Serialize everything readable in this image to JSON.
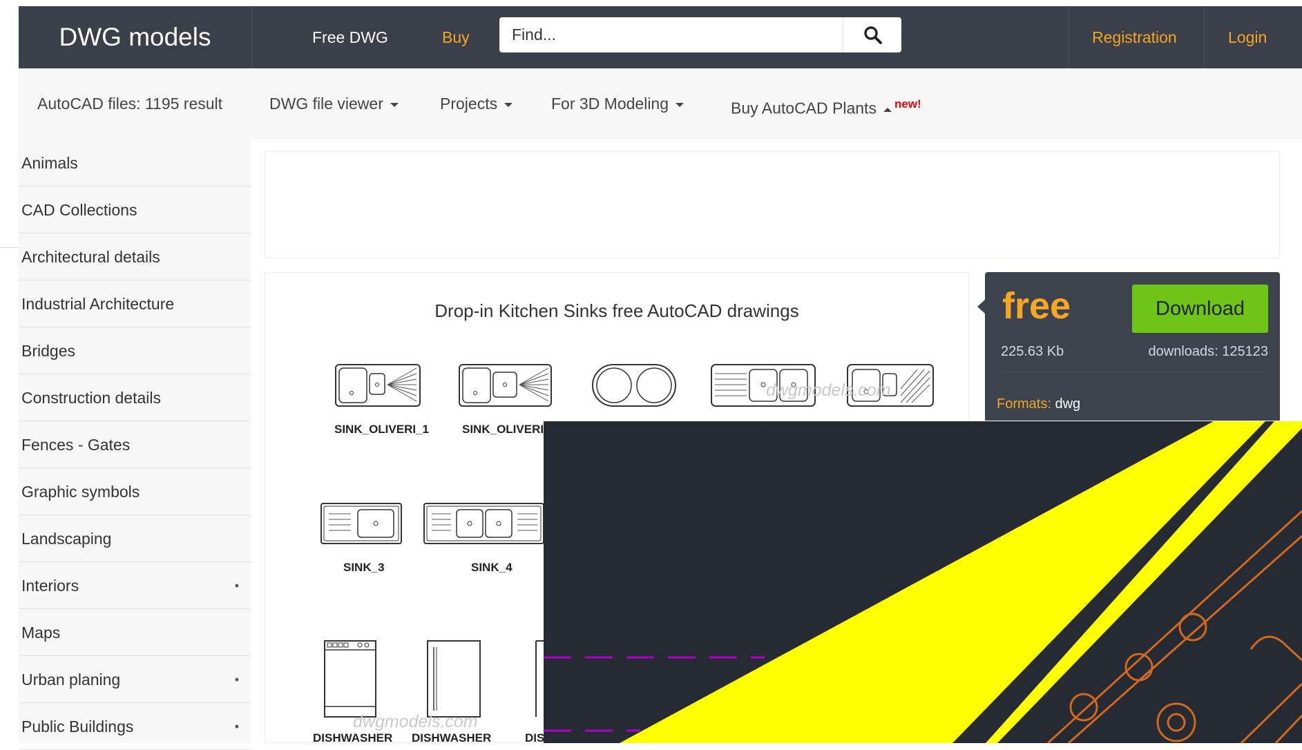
{
  "header": {
    "logo": "DWG models",
    "free_dwg": "Free DWG",
    "buy": "Buy",
    "search_placeholder": "Find...",
    "registration": "Registration",
    "login": "Login"
  },
  "subnav": {
    "result_text": "AutoCAD files: 1195 result",
    "items": [
      {
        "label": "DWG file viewer"
      },
      {
        "label": "Projects"
      },
      {
        "label": "For 3D Modeling"
      },
      {
        "label": "Buy AutoCAD Plants"
      }
    ],
    "new_badge": "new!"
  },
  "sidebar": {
    "items": [
      {
        "label": "Animals",
        "sub": ""
      },
      {
        "label": "CAD Collections",
        "sub": ""
      },
      {
        "label": "Architectural details",
        "sub": ""
      },
      {
        "label": "Industrial Architecture",
        "sub": ""
      },
      {
        "label": "Bridges",
        "sub": ""
      },
      {
        "label": "Construction details",
        "sub": ""
      },
      {
        "label": "Fences - Gates",
        "sub": ""
      },
      {
        "label": "Graphic symbols",
        "sub": ""
      },
      {
        "label": "Landscaping",
        "sub": ""
      },
      {
        "label": "Interiors",
        "sub": "•"
      },
      {
        "label": "Maps",
        "sub": ""
      },
      {
        "label": "Urban planing",
        "sub": "•"
      },
      {
        "label": "Public Buildings",
        "sub": "•"
      }
    ]
  },
  "content": {
    "title": "Drop-in Kitchen Sinks free AutoCAD drawings",
    "watermark": "dwgmodels.com",
    "labels": [
      "SINK_OLIVERI_1",
      "SINK_OLIVERI",
      "SINK_3",
      "SINK_4",
      "DISHWASHER",
      "DISHWASHER",
      "DIS"
    ]
  },
  "download": {
    "price": "free",
    "button": "Download",
    "size": "225.63 Kb",
    "downloads": "downloads: 125123",
    "formats_label": "Formats:",
    "formats_value": "dwg"
  },
  "colors": {
    "header_bg": "#3a3f49",
    "accent": "#f5a623",
    "download_btn": "#6ec517",
    "overlay_bg": "#262a33",
    "stripe": "#ffff00",
    "cad_orange": "#d2691e",
    "cad_magenta": "#b000d0"
  }
}
